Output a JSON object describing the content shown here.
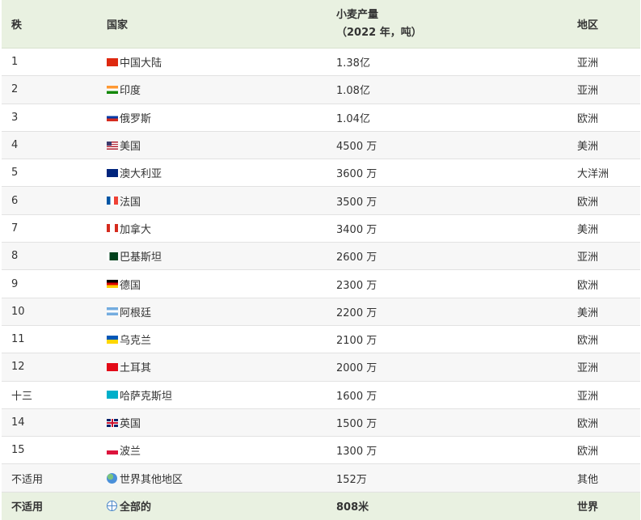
{
  "header": {
    "rank": "秩",
    "country": "国家",
    "production_line1": "小麦产量",
    "production_line2": "（2022 年，吨）",
    "region": "地区"
  },
  "rows": [
    {
      "rank": "1",
      "country": "中国大陆",
      "production": "1.38亿",
      "region": "亚洲",
      "flag_icon": "china-flag-icon"
    },
    {
      "rank": "2",
      "country": "印度",
      "production": "1.08亿",
      "region": "亚洲",
      "flag_icon": "india-flag-icon"
    },
    {
      "rank": "3",
      "country": "俄罗斯",
      "production": "1.04亿",
      "region": "欧洲",
      "flag_icon": "russia-flag-icon"
    },
    {
      "rank": "4",
      "country": "美国",
      "production": "4500 万",
      "region": "美洲",
      "flag_icon": "usa-flag-icon"
    },
    {
      "rank": "5",
      "country": "澳大利亚",
      "production": "3600 万",
      "region": "大洋洲",
      "flag_icon": "australia-flag-icon"
    },
    {
      "rank": "6",
      "country": "法国",
      "production": "3500 万",
      "region": "欧洲",
      "flag_icon": "france-flag-icon"
    },
    {
      "rank": "7",
      "country": "加拿大",
      "production": "3400 万",
      "region": "美洲",
      "flag_icon": "canada-flag-icon"
    },
    {
      "rank": "8",
      "country": "巴基斯坦",
      "production": "2600 万",
      "region": "亚洲",
      "flag_icon": "pakistan-flag-icon"
    },
    {
      "rank": "9",
      "country": "德国",
      "production": "2300 万",
      "region": "欧洲",
      "flag_icon": "germany-flag-icon"
    },
    {
      "rank": "10",
      "country": "阿根廷",
      "production": "2200 万",
      "region": "美洲",
      "flag_icon": "argentina-flag-icon"
    },
    {
      "rank": "11",
      "country": "乌克兰",
      "production": "2100 万",
      "region": "欧洲",
      "flag_icon": "ukraine-flag-icon"
    },
    {
      "rank": "12",
      "country": "土耳其",
      "production": "2000 万",
      "region": "亚洲",
      "flag_icon": "turkey-flag-icon"
    },
    {
      "rank": "十三",
      "country": "哈萨克斯坦",
      "production": "1600 万",
      "region": "亚洲",
      "flag_icon": "kazakhstan-flag-icon"
    },
    {
      "rank": "14",
      "country": "英国",
      "production": "1500 万",
      "region": "欧洲",
      "flag_icon": "uk-flag-icon"
    },
    {
      "rank": "15",
      "country": "波兰",
      "production": "1300 万",
      "region": "欧洲",
      "flag_icon": "poland-flag-icon"
    },
    {
      "rank": "不适用",
      "country": "世界其他地区",
      "production": "152万",
      "region": "其他",
      "flag_icon": "globe-icon"
    }
  ],
  "footer": {
    "rank": "不适用",
    "country": "全部的",
    "production": "808米",
    "region": "世界",
    "icon": "world-grid-icon"
  },
  "colors": {
    "header_bg": "#e9f1e1",
    "alt_row_bg": "#f7f7f7",
    "border": "#e2e2e2"
  }
}
